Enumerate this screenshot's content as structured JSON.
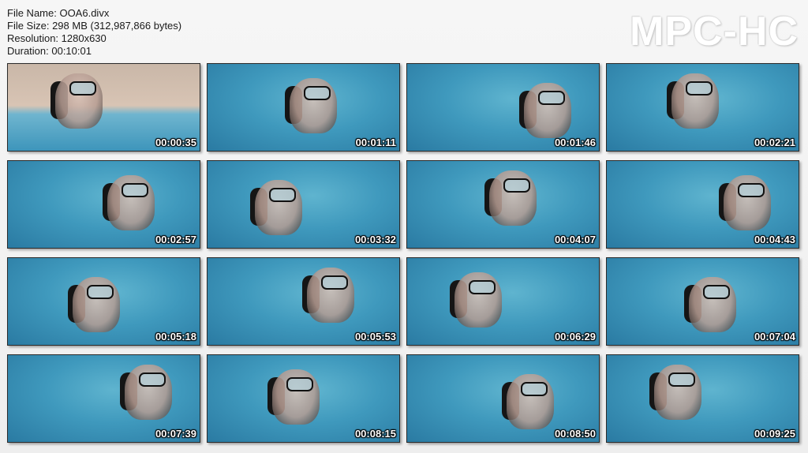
{
  "file_info": {
    "file_name": "File Name: OOA6.divx",
    "file_size": "File Size: 298 MB (312,987,866 bytes)",
    "resolution": "Resolution: 1280x630",
    "duration": "Duration: 00:10:01"
  },
  "logo": "MPC-HC",
  "thumbnails": [
    {
      "time": "00:00:35",
      "scene": "surface"
    },
    {
      "time": "00:01:11",
      "scene": "underwater"
    },
    {
      "time": "00:01:46",
      "scene": "underwater"
    },
    {
      "time": "00:02:21",
      "scene": "underwater"
    },
    {
      "time": "00:02:57",
      "scene": "underwater"
    },
    {
      "time": "00:03:32",
      "scene": "underwater"
    },
    {
      "time": "00:04:07",
      "scene": "underwater"
    },
    {
      "time": "00:04:43",
      "scene": "underwater"
    },
    {
      "time": "00:05:18",
      "scene": "underwater"
    },
    {
      "time": "00:05:53",
      "scene": "underwater"
    },
    {
      "time": "00:06:29",
      "scene": "underwater"
    },
    {
      "time": "00:07:04",
      "scene": "underwater"
    },
    {
      "time": "00:07:39",
      "scene": "underwater"
    },
    {
      "time": "00:08:15",
      "scene": "underwater"
    },
    {
      "time": "00:08:50",
      "scene": "underwater"
    },
    {
      "time": "00:09:25",
      "scene": "underwater"
    }
  ]
}
